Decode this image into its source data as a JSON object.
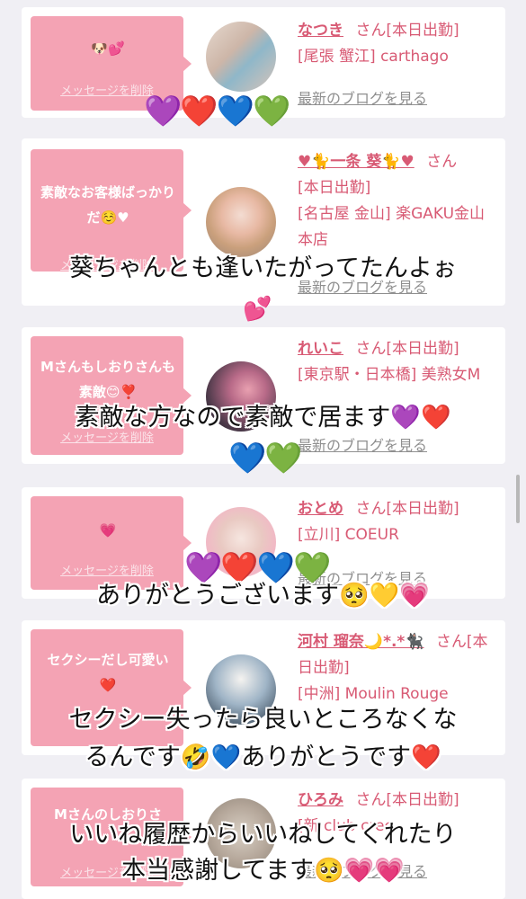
{
  "common": {
    "delete_label": "メッセージを削除",
    "blog_label": "最新のブログを見る"
  },
  "cards": [
    {
      "message": "🐶💕",
      "name": "なつき",
      "line1_suffix": "さん[本日出勤]",
      "line2": "[尾張 蟹江] carthago",
      "line3": ""
    },
    {
      "message": "素敵なお客様ばっかりだ☺️♥",
      "name": "♥🐈一条 葵🐈♥",
      "line1_suffix": "さん",
      "line2": "[本日出勤]",
      "line3": "[名古屋 金山] 楽GAKU金山本店"
    },
    {
      "message": "Mさんもしおりさんも素敵😊❣️",
      "name": "れいこ",
      "line1_suffix": "さん[本日出勤]",
      "line2": "[東京駅・日本橋] 美熟女M",
      "line3": ""
    },
    {
      "message": "💗",
      "name": "おとめ",
      "line1_suffix": "さん[本日出勤]",
      "line2": "[立川] COEUR",
      "line3": ""
    },
    {
      "message": "セクシーだし可愛い❤️",
      "name": "河村 瑠奈🌙*.*🐈‍⬛",
      "line1_suffix": "さん[本日出勤]",
      "line2": "[中洲] Moulin Rouge",
      "line3": ""
    },
    {
      "message": "Mさんのしおりさ",
      "name": "ひろみ",
      "line1_suffix": "さん[本日出勤]",
      "line2": "[新 club cree",
      "line3": ""
    }
  ],
  "overlay": {
    "caption1": "葵ちゃんとも逢いたがってたんよぉ",
    "caption2": "素敵な方なので素敵で居ます",
    "caption3": "ありがとうございます",
    "caption4_line1": "セクシー失ったら良いところなくな",
    "caption4_line2": "るんです",
    "caption4_line2b": "ありがとうです",
    "caption5_line1": "いいね履歴からいいねしてくれたり",
    "caption5_line2": "本当感謝してます",
    "heart_purple": "💜",
    "heart_red": "❤️",
    "heart_blue": "💙",
    "heart_green": "💚",
    "two_hearts": "💕",
    "pleading": "🥺",
    "yellow_heart": "💛",
    "growing_heart": "💗",
    "rofl": "🤣"
  },
  "colors": {
    "background": "#f0eff4",
    "bubble": "#f4a3b4",
    "name": "#d85a74",
    "link_gray": "#8f8f8f"
  }
}
